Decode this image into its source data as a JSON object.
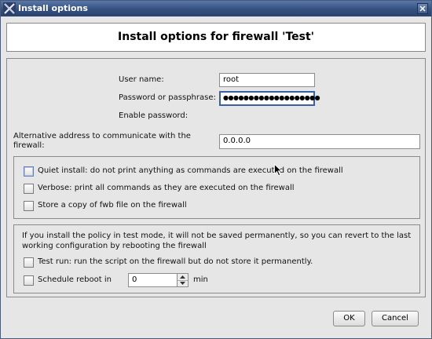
{
  "window": {
    "title": "Install options",
    "header": "Install options for firewall 'Test'"
  },
  "credentials": {
    "user_name_label": "User name:",
    "user_name_value": "root",
    "password_label": "Password or passphrase:",
    "password_value": "●●●●●●●●●●●●●●●●●●●",
    "enable_password_label": "Enable password:"
  },
  "address": {
    "label_line1": "Alternative address to communicate with the",
    "label_line2": "firewall:",
    "value": "0.0.0.0"
  },
  "options": {
    "quiet_label": "Quiet install: do not print anything as commands are executed on the firewall",
    "verbose_label": "Verbose: print all commands as they are executed on the firewall",
    "store_copy_label": "Store a copy of fwb file on the firewall"
  },
  "test_mode": {
    "note_line1": "If you install the policy in test mode, it will not be saved permanently, so you can revert to the last",
    "note_line2": "working configuration by rebooting the firewall",
    "test_run_label": "Test run: run the script on the firewall but do not store it permanently.",
    "schedule_label": "Schedule reboot in",
    "schedule_value": "0",
    "schedule_unit": "min"
  },
  "buttons": {
    "ok": "OK",
    "cancel": "Cancel"
  },
  "icons": {
    "app": "x-logo-icon",
    "close": "close-icon",
    "cursor": "mouse-pointer-icon"
  }
}
